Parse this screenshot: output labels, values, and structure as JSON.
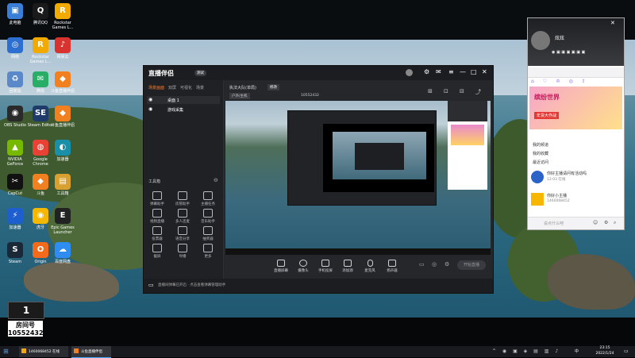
{
  "desktop": {
    "icons": [
      {
        "label": "此电脑",
        "icon": "computer-icon",
        "color": "#3b7ed8",
        "glyph": "▣"
      },
      {
        "label": "腾讯QQ",
        "icon": "qq-icon",
        "color": "#1a1a1a",
        "glyph": "Q"
      },
      {
        "label": "Rockstar Games L...",
        "icon": "rockstar-icon",
        "color": "#f2a900",
        "glyph": "R"
      },
      {
        "label": "网络",
        "icon": "network-icon",
        "color": "#2d6fd0",
        "glyph": "◎"
      },
      {
        "label": "Rockstar Games L...",
        "icon": "rockstar-icon",
        "color": "#f2a900",
        "glyph": "R"
      },
      {
        "label": "网易云",
        "icon": "netease-music-icon",
        "color": "#d8332e",
        "glyph": "♪"
      },
      {
        "label": "回收站",
        "icon": "recycle-bin-icon",
        "color": "#5a88c9",
        "glyph": "♻"
      },
      {
        "label": "微信",
        "icon": "wechat-icon",
        "color": "#2aae67",
        "glyph": "✉"
      },
      {
        "label": "斗鱼直播伴侣",
        "icon": "douyu-companion-icon",
        "color": "#f08020",
        "glyph": "◆"
      },
      {
        "label": "OBS Studio",
        "icon": "obs-icon",
        "color": "#2a2a2a",
        "glyph": "◉"
      },
      {
        "label": "Steam Editor",
        "icon": "se-icon",
        "color": "#1f3b6a",
        "glyph": "SE"
      },
      {
        "label": "斗鱼直播伴侣",
        "icon": "douyu-companion-icon",
        "color": "#f08020",
        "glyph": "◆"
      },
      {
        "label": "NVIDIA GeForce",
        "icon": "nvidia-icon",
        "color": "#76b900",
        "glyph": "▲"
      },
      {
        "label": "Google Chrome",
        "icon": "chrome-icon",
        "color": "#e94235",
        "glyph": "◍"
      },
      {
        "label": "加速器",
        "icon": "accelerator-icon",
        "color": "#1a8fa8",
        "glyph": "◐"
      },
      {
        "label": "CapCut",
        "icon": "capcut-icon",
        "color": "#111111",
        "glyph": "✂"
      },
      {
        "label": "斗鱼",
        "icon": "douyu-icon",
        "color": "#f08020",
        "glyph": "◆"
      },
      {
        "label": "工具箱",
        "icon": "toolbox-icon",
        "color": "#d8a030",
        "glyph": "▤"
      },
      {
        "label": "加速器",
        "icon": "accelerator-icon",
        "color": "#1e5fcf",
        "glyph": "⚡"
      },
      {
        "label": "虎牙",
        "icon": "huya-icon",
        "color": "#f5b700",
        "glyph": "◉"
      },
      {
        "label": "Epic Games Launcher",
        "icon": "epic-icon",
        "color": "#222",
        "glyph": "E"
      },
      {
        "label": "Steam",
        "icon": "steam-icon",
        "color": "#1b2838",
        "glyph": "S"
      },
      {
        "label": "Origin",
        "icon": "origin-icon",
        "color": "#f26b1d",
        "glyph": "O"
      },
      {
        "label": "百度网盘",
        "icon": "baidu-netdisk-icon",
        "color": "#2f8cf0",
        "glyph": "☁"
      }
    ]
  },
  "room_badge": {
    "label": "房间号",
    "number": "10552432"
  },
  "companion": {
    "title": "直播伴侣",
    "badge": "测试",
    "scene_tabs": [
      "场景画面",
      "双屏",
      "可视化",
      "场景"
    ],
    "sources": [
      "桌面 1",
      "游戏采集"
    ],
    "toolbox_label": "工具箱",
    "tools": [
      "弹幕助手",
      "房管助手",
      "主播任务",
      "视频直播",
      "多人连麦",
      "音乐助手",
      "投票器",
      "语音分享",
      "抽奖器",
      "截屏",
      "导播",
      "更多"
    ],
    "stream_title": "执法大队(单局)",
    "stream_title_tag": "修改",
    "room_id": "10552432",
    "category": "户外/主机",
    "status_notice": "直播间弹幕已开启 · 点击查看弹幕管理助手",
    "controls": [
      "直播屏幕",
      "摄像头",
      "手机投屏",
      "添加源",
      "麦克风",
      "扬声器"
    ],
    "start_button": "开始直播"
  },
  "chat": {
    "user": "炫炫",
    "sections": [
      "我的频道",
      "我的收藏",
      "最近访问"
    ],
    "banner_title": "缤纷世界",
    "banner_subtitle": "年货大作战",
    "messages": [
      {
        "text": "你好主播请问有活动吗",
        "sub": "12:03 在线"
      },
      {
        "text": "你好小主播",
        "sub": "1460068452"
      }
    ],
    "input_placeholder": "说点什么吧"
  },
  "taskbar": {
    "items": [
      "1460068452 在线",
      "斗鱼直播伴侣"
    ],
    "time": "23:15",
    "date": "2022/1/24",
    "ime": "中"
  }
}
